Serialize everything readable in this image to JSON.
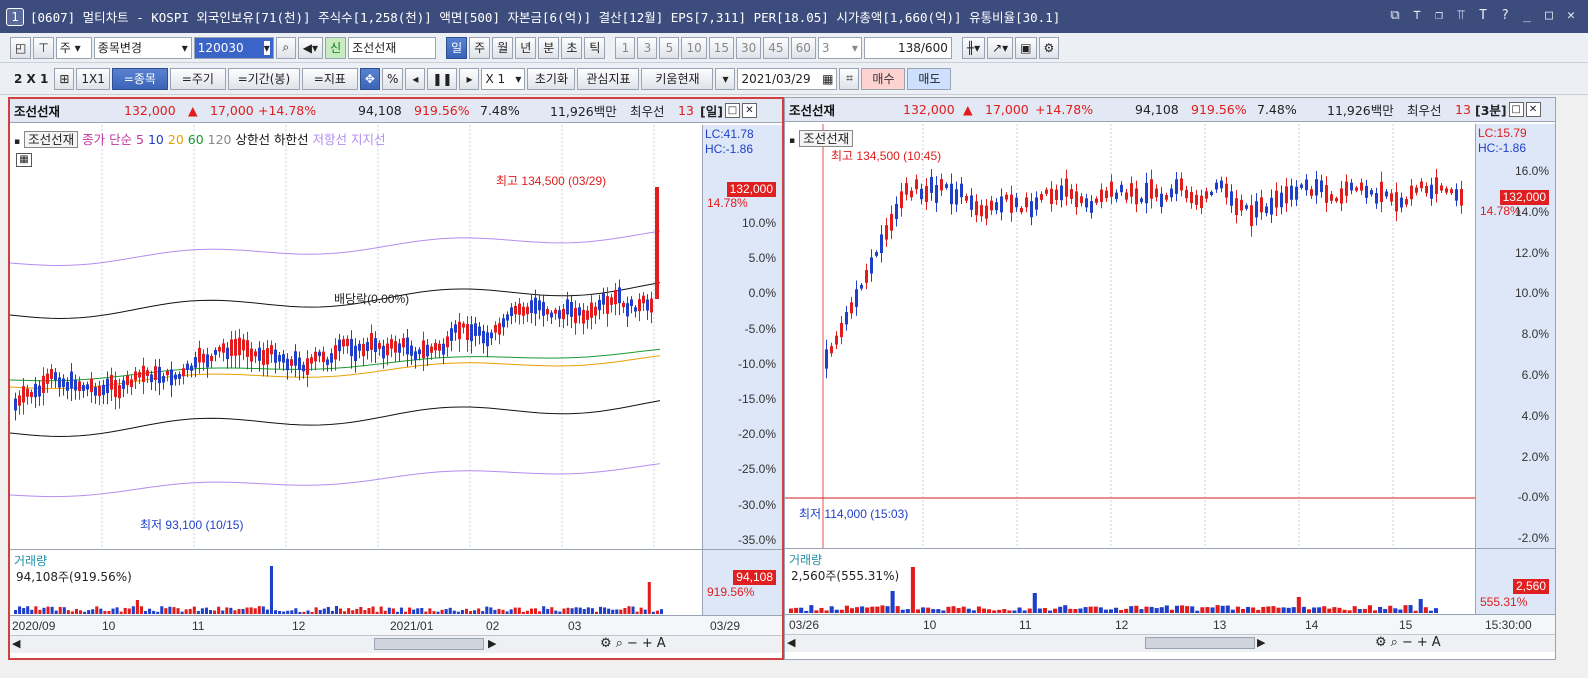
{
  "title": {
    "appnum": "1",
    "text": "[0607] 멀티차트 - KOSPI 외국인보유[71(천)] 주식수[1,258(천)] 액면[500] 자본금[6(억)] 결산[12월] EPS[7,311] PER[18.05] 시가총액[1,660(억)] 유통비율[30.1]"
  },
  "toolbar1": {
    "mode": "주",
    "change": "종목변경",
    "code": "120030",
    "sin": "신",
    "name": "조선선재",
    "periods": [
      "일",
      "주",
      "월",
      "년",
      "분",
      "초",
      "틱"
    ],
    "numbers": [
      "1",
      "3",
      "5",
      "10",
      "15",
      "30",
      "45",
      "60"
    ],
    "count": "3",
    "range": "138",
    "range_total": "/600"
  },
  "toolbar2": {
    "grid": "2 X 1",
    "one": "1X1",
    "btn_stock": "=종목",
    "btn_period": "=주기",
    "btn_range": "=기간(봉)",
    "btn_index": "=지표",
    "pct": "%",
    "mult": "X 1",
    "reset": "초기화",
    "fav": "관심지표",
    "kiwoom": "키움현재",
    "date": "2021/03/29",
    "buy": "매수",
    "sell": "매도"
  },
  "left": {
    "name": "조선선재",
    "price": "132,000",
    "arrow": "▲",
    "change": "17,000",
    "pct": "+14.78%",
    "vol": "94,108",
    "volpct": "919.56%",
    "turn": "7.48%",
    "amount": "11,926백만",
    "pref": "최우선",
    "tail": "13",
    "period": "[일]",
    "legend": {
      "name": "조선선재",
      "ma": "종가 단순 5",
      "m10": "10",
      "m20": "20",
      "m60": "60",
      "m120": "120",
      "up": "상한선",
      "down": "하한선",
      "res": "저항선",
      "sup": "지지선"
    },
    "lc": "LC:41.78",
    "hc": "HC:-1.86",
    "high": "최고 134,500 (03/29)",
    "low": "최저 93,100 (10/15)",
    "div": "배당락(0.00%)",
    "tag_price": "132,000",
    "tag_pct": "14.78%",
    "yticks": [
      "10.0%",
      "5.0%",
      "0.0%",
      "-5.0%",
      "-10.0%",
      "-15.0%",
      "-20.0%",
      "-25.0%",
      "-30.0%",
      "-35.0%"
    ],
    "vol_title": "거래량",
    "vol_text": "94,108주(919.56%)",
    "vol_tag": "94,108",
    "vol_tag2": "919.56%",
    "xticks": [
      "2020/09",
      "10",
      "11",
      "12",
      "2021/01",
      "02",
      "03",
      "03/29"
    ]
  },
  "right": {
    "name": "조선선재",
    "price": "132,000",
    "arrow": "▲",
    "change": "17,000",
    "pct": "+14.78%",
    "vol": "94,108",
    "volpct": "919.56%",
    "turn": "7.48%",
    "amount": "11,926백만",
    "pref": "최우선",
    "tail": "13",
    "period": "[3분]",
    "legend": {
      "name": "조선선재"
    },
    "lc": "LC:15.79",
    "hc": "HC:-1.86",
    "high": "최고 134,500 (10:45)",
    "low": "최저 114,000 (15:03)",
    "tag_price": "132,000",
    "tag_pct": "14.78%",
    "yticks": [
      "16.0%",
      "14.0%",
      "12.0%",
      "10.0%",
      "8.0%",
      "6.0%",
      "4.0%",
      "2.0%",
      "-0.0%",
      "-2.0%"
    ],
    "vol_title": "거래량",
    "vol_text": "2,560주(555.31%)",
    "vol_tag": "2,560",
    "vol_tag2": "555.31%",
    "xticks": [
      "03/26",
      "10",
      "11",
      "12",
      "13",
      "14",
      "15",
      "15:30:00"
    ]
  },
  "colors": {
    "up": "#e01c1c",
    "down": "#1f3fc8",
    "title_bg": "#3c4c7c",
    "axis_bg": "#dde7f7"
  }
}
